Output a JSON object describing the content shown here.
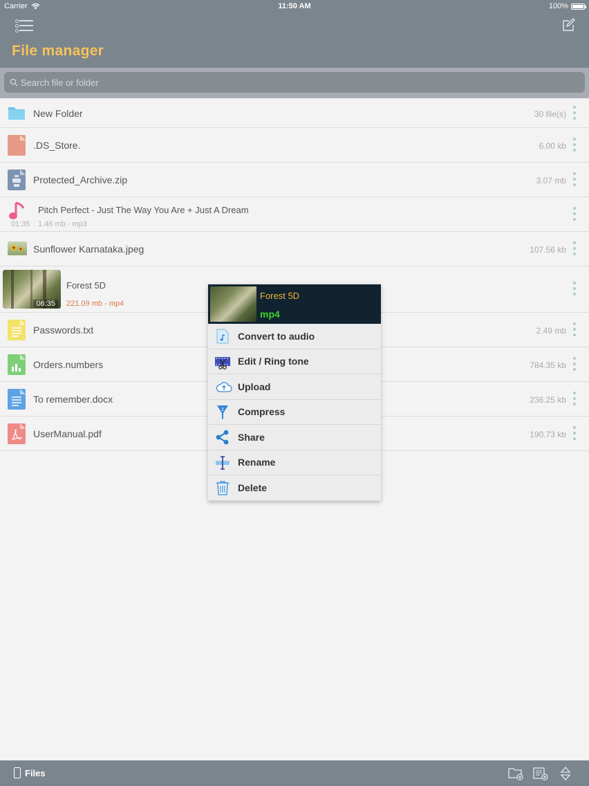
{
  "status": {
    "carrier": "Carrier",
    "time": "11:50 AM",
    "battery": "100%"
  },
  "header": {
    "title": "File manager"
  },
  "search": {
    "placeholder": "Search file or folder"
  },
  "files": [
    {
      "name": "New Folder",
      "size": "30 file(s)"
    },
    {
      "name": ".DS_Store.",
      "size": "6.00 kb"
    },
    {
      "name": "Protected_Archive.zip",
      "size": "3.07 mb"
    },
    {
      "name": "Pitch Perfect - Just The Way You Are + Just A Dream",
      "duration": "01:35",
      "meta": "1.46 mb - mp3"
    },
    {
      "name": "Sunflower Karnataka.jpeg",
      "size": "107.56 kb"
    },
    {
      "name": "Forest 5D",
      "duration": "06:35",
      "meta": "221.09 mb - mp4"
    },
    {
      "name": "Passwords.txt",
      "size": "2.49 mb"
    },
    {
      "name": "Orders.numbers",
      "size": "784.35 kb"
    },
    {
      "name": "To remember.docx",
      "size": "236.25 kb"
    },
    {
      "name": "UserManual.pdf",
      "size": "190.73 kb"
    }
  ],
  "context_menu": {
    "title": "Forest 5D",
    "type": "mp4",
    "items": [
      {
        "label": "Convert to audio",
        "icon": "music-file-icon"
      },
      {
        "label": "Edit / Ring tone",
        "icon": "film-scissors-icon"
      },
      {
        "label": "Upload",
        "icon": "cloud-upload-icon"
      },
      {
        "label": "Compress",
        "icon": "compress-icon"
      },
      {
        "label": "Share",
        "icon": "share-icon"
      },
      {
        "label": "Rename",
        "icon": "rename-cursor-icon"
      },
      {
        "label": "Delete",
        "icon": "trash-icon"
      }
    ]
  },
  "bottom": {
    "files_label": "Files"
  },
  "colors": {
    "header": "#7b858d",
    "title": "#f7c45a",
    "menu_head": "#112331",
    "menu_type": "#3ed427",
    "menu_title": "#f1b533",
    "video_meta": "#e0774a"
  }
}
